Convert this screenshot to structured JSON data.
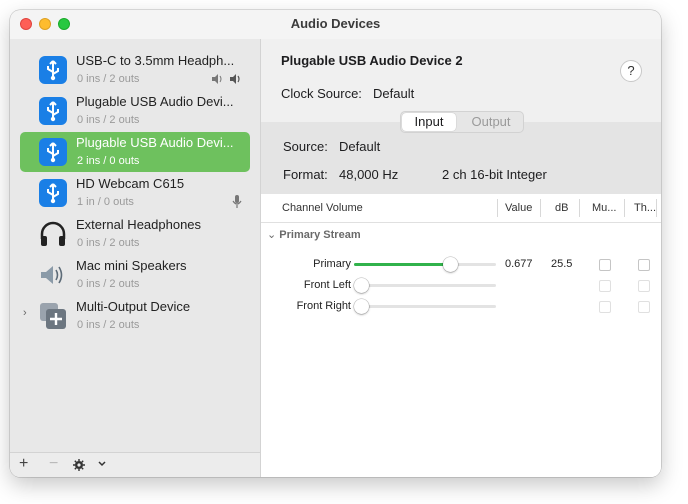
{
  "window": {
    "title": "Audio Devices"
  },
  "colors": {
    "accent_green": "#6ec15e",
    "slider_green": "#31b24b"
  },
  "sidebar": {
    "devices": [
      {
        "name": "USB-C to 3.5mm Headph...",
        "sub": "0 ins / 2 outs",
        "icon": "usb-icon"
      },
      {
        "name": "Plugable USB Audio Devi...",
        "sub": "0 ins / 2 outs",
        "icon": "usb-icon"
      },
      {
        "name": "Plugable USB Audio Devi...",
        "sub": "2 ins / 0 outs",
        "icon": "usb-icon",
        "selected": true
      },
      {
        "name": "HD Webcam C615",
        "sub": "1 in / 0 outs",
        "icon": "usb-icon"
      },
      {
        "name": "External Headphones",
        "sub": "0 ins / 2 outs",
        "icon": "headphones-icon"
      },
      {
        "name": "Mac mini Speakers",
        "sub": "0 ins / 2 outs",
        "icon": "speaker-icon"
      },
      {
        "name": "Multi-Output Device",
        "sub": "0 ins / 2 outs",
        "icon": "multi-output-icon"
      }
    ],
    "footer": {
      "add": "+",
      "remove": "−"
    }
  },
  "detail": {
    "device_title": "Plugable USB Audio Device 2",
    "help": "?",
    "clock_label": "Clock Source:",
    "clock_value": "Default",
    "tabs": {
      "input": "Input",
      "output": "Output",
      "selected": "input"
    },
    "source_label": "Source:",
    "source_value": "Default",
    "format_label": "Format:",
    "format_value": "48,000 Hz",
    "format_bits": "2 ch 16-bit Integer",
    "table": {
      "headers": {
        "channel": "Channel Volume",
        "value": "Value",
        "db": "dB",
        "mute": "Mu...",
        "thru": "Th..."
      },
      "group": "Primary Stream",
      "rows": [
        {
          "label": "Primary",
          "value": "0.677",
          "db": "25.5",
          "level": 0.677
        },
        {
          "label": "Front Left",
          "value": "",
          "db": "",
          "level": 0
        },
        {
          "label": "Front Right",
          "value": "",
          "db": "",
          "level": 0
        }
      ]
    }
  }
}
